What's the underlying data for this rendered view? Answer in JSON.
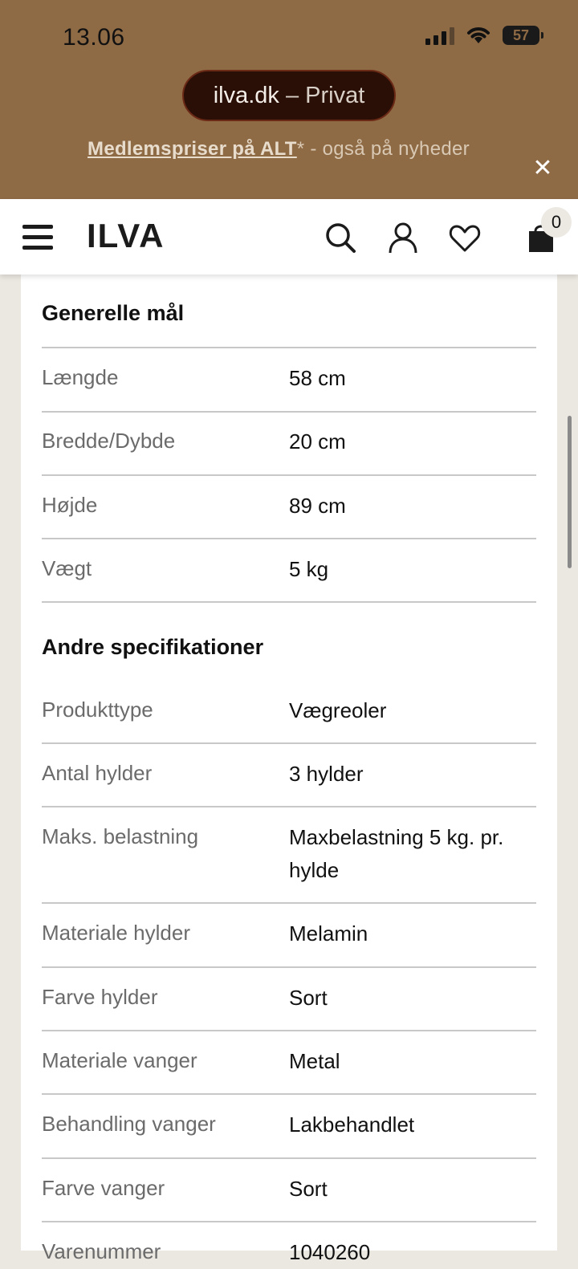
{
  "status_bar": {
    "time": "13.06",
    "battery": "57"
  },
  "browser": {
    "domain": "ilva.dk",
    "mode": "– Privat"
  },
  "promo": {
    "link": "Medlemspriser på ALT",
    "rest": "* - også på nyheder"
  },
  "header": {
    "logo": "ILVA",
    "cart_count": "0"
  },
  "sections": {
    "general": {
      "title": "Generelle mål",
      "rows": [
        {
          "label": "Længde",
          "value": "58 cm"
        },
        {
          "label": "Bredde/Dybde",
          "value": "20 cm"
        },
        {
          "label": "Højde",
          "value": "89 cm"
        },
        {
          "label": "Vægt",
          "value": "5 kg"
        }
      ]
    },
    "other": {
      "title": "Andre specifikationer",
      "rows": [
        {
          "label": "Produkttype",
          "value": "Vægreoler"
        },
        {
          "label": "Antal hylder",
          "value": "3 hylder"
        },
        {
          "label": "Maks. belastning",
          "value": "Maxbelastning 5 kg. pr. hylde"
        },
        {
          "label": "Materiale hylder",
          "value": "Melamin"
        },
        {
          "label": "Farve hylder",
          "value": "Sort"
        },
        {
          "label": "Materiale vanger",
          "value": "Metal"
        },
        {
          "label": "Behandling vanger",
          "value": "Lakbehandlet"
        },
        {
          "label": "Farve vanger",
          "value": "Sort"
        },
        {
          "label": "Varenummer",
          "value": "1040260"
        }
      ]
    }
  },
  "colors": {
    "banner": "#8e6a45",
    "pill": "#2a0f07",
    "page_bg": "#ebe7e1"
  },
  "icons": [
    "signal-icon",
    "wifi-icon",
    "battery-icon",
    "close-icon",
    "menu-icon",
    "search-icon",
    "account-icon",
    "heart-icon",
    "bag-icon"
  ]
}
